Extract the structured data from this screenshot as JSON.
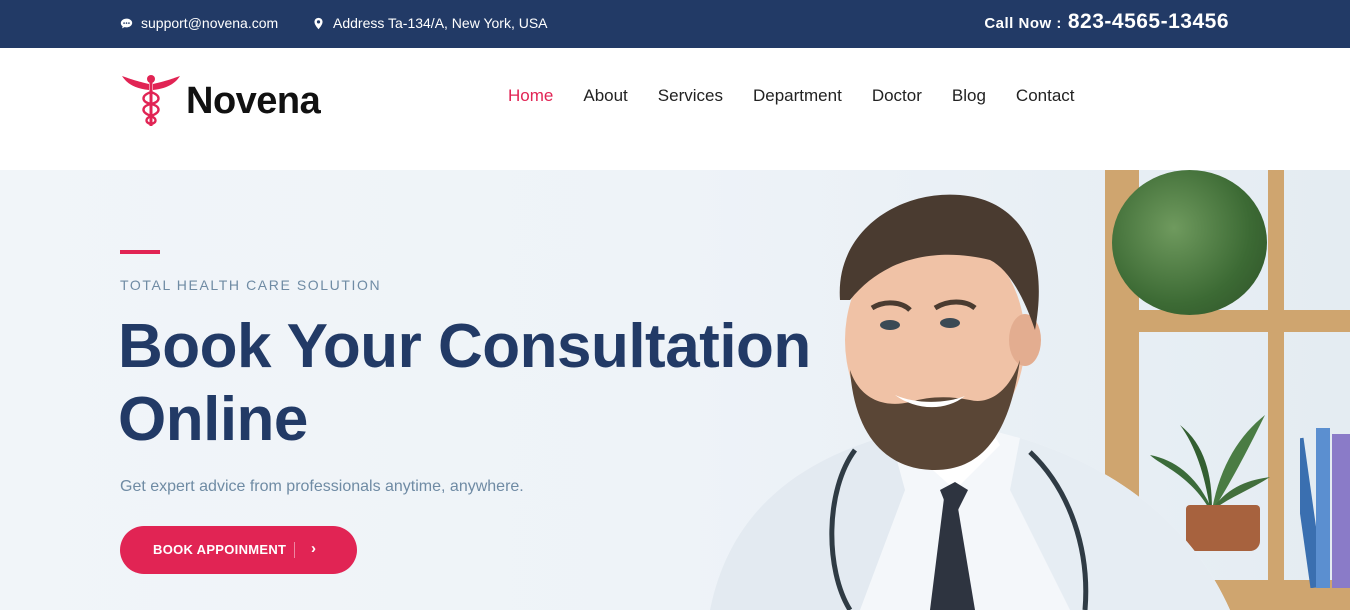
{
  "topbar": {
    "email": "support@novena.com",
    "address": "Address Ta-134/A, New York, USA",
    "call_label": "Call Now :",
    "call_number": "823-4565-13456",
    "background": "#223a66"
  },
  "header": {
    "brand": "Novena",
    "nav": [
      {
        "label": "Home",
        "active": true
      },
      {
        "label": "About"
      },
      {
        "label": "Services"
      },
      {
        "label": "Department"
      },
      {
        "label": "Doctor"
      },
      {
        "label": "Blog"
      },
      {
        "label": "Contact"
      }
    ],
    "stray_text": ";"
  },
  "hero": {
    "tagline": "TOTAL HEALTH CARE SOLUTION",
    "headline": "Book Your Consultation Online",
    "subtext": "Get expert advice from professionals anytime, anywhere.",
    "button_label": "BOOK APPOINMENT",
    "button_icon": "chevron-right-icon",
    "accent_color": "#e12454",
    "headline_color": "#223a66"
  }
}
